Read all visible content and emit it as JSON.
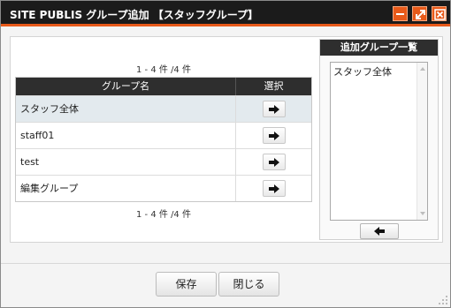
{
  "window": {
    "title": "SITE PUBLIS グループ追加 【スタッフグループ】",
    "accent_color": "#e85a1a",
    "titlebar_color": "#1b1b1b",
    "icons": [
      "minimize-icon",
      "maximize-icon",
      "close-icon"
    ]
  },
  "group_table": {
    "pager_top": "1 - 4 件 /4 件",
    "pager_bottom": "1 - 4 件 /4 件",
    "columns": {
      "name": "グループ名",
      "select": "選択"
    },
    "rows": [
      {
        "name": "スタッフ全体",
        "selected": true
      },
      {
        "name": "staff01"
      },
      {
        "name": "test"
      },
      {
        "name": "編集グループ"
      }
    ]
  },
  "added_panel": {
    "title": "追加グループ一覧",
    "items": [
      "スタッフ全体"
    ]
  },
  "footer": {
    "save_label": "保存",
    "close_label": "閉じる"
  }
}
